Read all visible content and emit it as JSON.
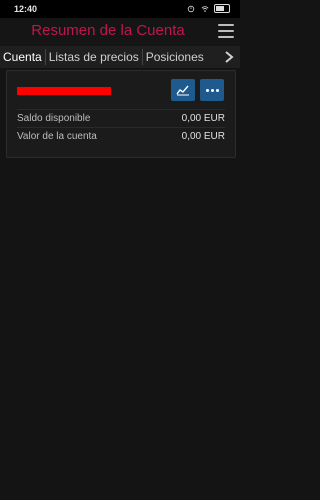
{
  "status": {
    "time": "12:40"
  },
  "header": {
    "title": "Resumen de la Cuenta"
  },
  "tabs": [
    {
      "label": "Cuenta"
    },
    {
      "label": "Listas de precios"
    },
    {
      "label": "Posiciones"
    }
  ],
  "account": {
    "rows": [
      {
        "label": "Saldo disponible",
        "value": "0,00 EUR"
      },
      {
        "label": "Valor de la cuenta",
        "value": "0,00 EUR"
      }
    ]
  },
  "colors": {
    "title": "#c0174b",
    "button": "#1f5a8e",
    "redaction": "#ff0000"
  }
}
